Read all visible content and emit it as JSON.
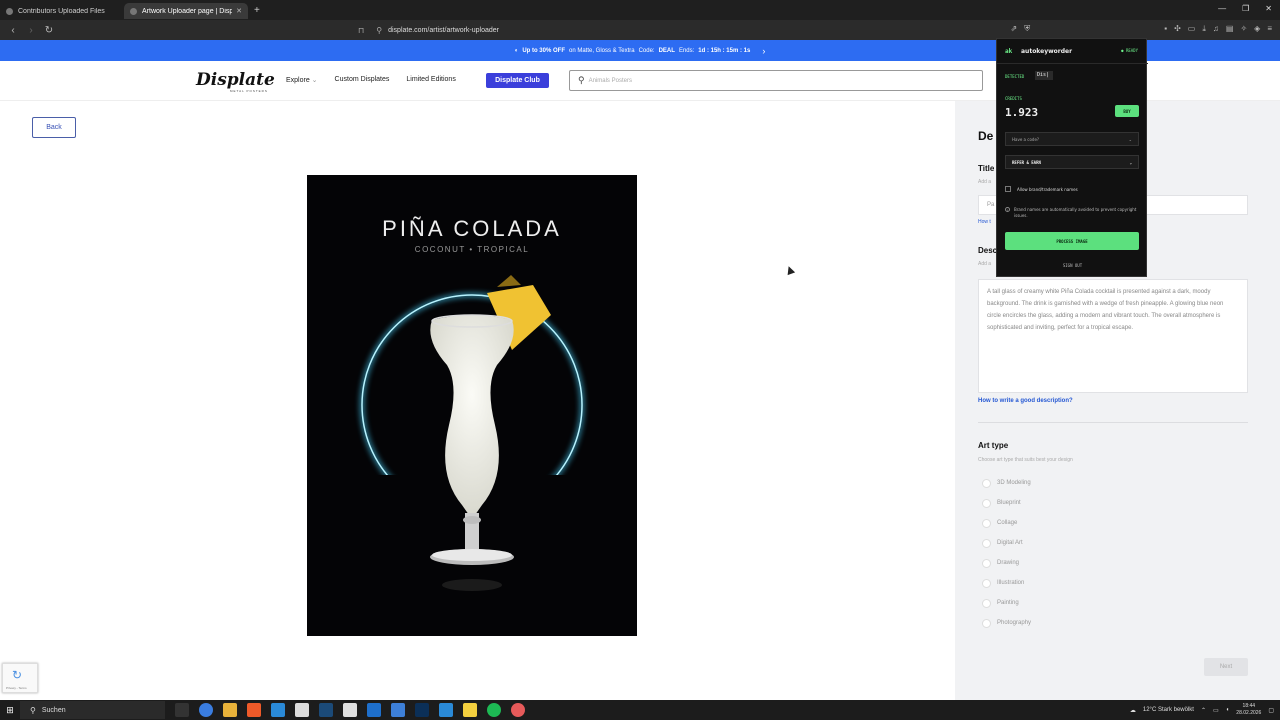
{
  "browser": {
    "tabs": [
      {
        "title": "Contributors Uploaded Files",
        "active": false
      },
      {
        "title": "Artwork Uploader page | Displa...",
        "active": true
      }
    ],
    "url": "displate.com/artist/artwork-uploader"
  },
  "promo": {
    "part1": "Up to 30% OFF",
    "part2": "on Matte, Gloss & Textra",
    "code_label": "Code:",
    "code": "DEAL",
    "ends_label": "Ends:",
    "ends_time": "1d : 15h : 15m : 1s"
  },
  "header": {
    "logo": "Displate",
    "logo_sub": "METAL POSTERS",
    "nav": [
      "Explore",
      "Custom Displates",
      "Limited Editions"
    ],
    "club_button": "Displate Club",
    "search_placeholder": "Animals Posters"
  },
  "main": {
    "back_button": "Back",
    "poster_title": "PIÑA COLADA",
    "poster_subtitle": "COCONUT • TROPICAL"
  },
  "panel": {
    "heading": "De",
    "title_label": "Title",
    "title_hint": "Add a",
    "title_value": "Pa",
    "title_link": "How t",
    "desc_label": "Desc",
    "desc_hint": "Add a",
    "description": "A tall glass of creamy white Piña Colada cocktail is presented against a dark, moody background. The drink is garnished with a wedge of fresh pineapple. A glowing blue neon circle encircles the glass, adding a modern and vibrant touch. The overall atmosphere is sophisticated and inviting, perfect for a tropical escape.",
    "desc_link": "How to write a good description?",
    "art_type_label": "Art type",
    "art_type_hint": "Choose art type that suits best your design",
    "art_types": [
      "3D Modeling",
      "Blueprint",
      "Collage",
      "Digital Art",
      "Drawing",
      "Illustration",
      "Painting",
      "Photography"
    ],
    "next_button": "Next"
  },
  "extension": {
    "logo": "ak",
    "name": "autokeyworder",
    "status": "● READY",
    "detected_label": "DETECTED",
    "detected_value": "Dis|",
    "credits_label": "CREDITS",
    "credits_value": "1.923",
    "buy_button": "BUY",
    "code_field": "Have a code?",
    "refer_button": "REFER & EARN",
    "allow_brand": "Allow brand/trademark names",
    "info": "Brand names are automatically avoided to prevent copyright issues.",
    "process_button": "PROCESS IMAGE",
    "signout": "SIGN OUT"
  },
  "recaptcha": {
    "text": "Privacy - Terms"
  },
  "taskbar": {
    "search": "Suchen",
    "weather": "12°C  Stark bewölkt",
    "time": "18:44",
    "date": "28.02.2026"
  },
  "colors": {
    "promo_blue": "#2d6cf2",
    "club_purple": "#3b3fdb",
    "extension_green": "#5ce07e",
    "neon_blue": "#7fe3ff"
  }
}
